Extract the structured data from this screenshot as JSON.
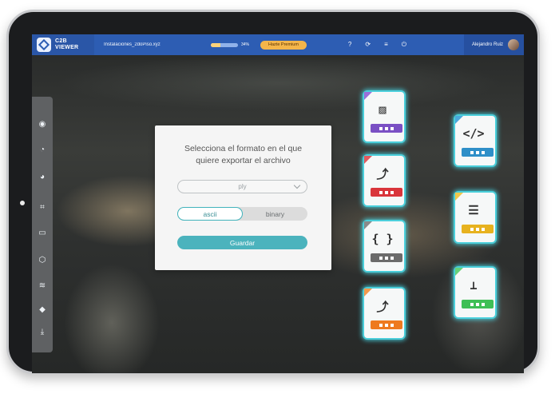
{
  "app": {
    "name_line1": "C2B",
    "name_line2": "VIEWER"
  },
  "file": {
    "name": "Instalaciones_2doPiso.xyz"
  },
  "progress": {
    "percent": 34,
    "label": "34%"
  },
  "premium": {
    "label": "Hazte Premium"
  },
  "header_icons": [
    "help-icon",
    "sync-icon",
    "menu-icon",
    "power-icon"
  ],
  "header_icon_glyphs": [
    "?",
    "⟳",
    "≡",
    "⏻"
  ],
  "user": {
    "name": "Alejandro Ruiz"
  },
  "sidebar": {
    "icons": [
      "target-icon",
      "palette-icon",
      "palette-add-icon",
      "crop-icon",
      "ruler-icon",
      "cube-icon",
      "layers-icon",
      "layer-fill-icon",
      "download-icon"
    ],
    "glyphs": [
      "◉",
      "◔",
      "◕",
      "⌗",
      "▭",
      "⬡",
      "≋",
      "◆",
      "⤓"
    ]
  },
  "dialog": {
    "title_line1": "Selecciona el formato en el que",
    "title_line2": "quiere exportar el archivo",
    "format": {
      "selected": "ply"
    },
    "encoding": {
      "options": [
        "ascii",
        "binary"
      ],
      "selected": "ascii"
    },
    "save_label": "Guardar"
  },
  "export_formats": [
    {
      "name": "image-file-icon",
      "color": "#7a50c4",
      "corner": "#9a6fd8",
      "glyph": "▨"
    },
    {
      "name": "code-file-icon",
      "color": "#2e8fc8",
      "corner": "#4aa9db",
      "glyph": "</>"
    },
    {
      "name": "vector-file-icon-red",
      "color": "#d9353b",
      "corner": "#e15a5f",
      "glyph": "⤴"
    },
    {
      "name": "form-file-icon",
      "color": "#e7b21f",
      "corner": "#f0c74a",
      "glyph": "☰"
    },
    {
      "name": "json-file-icon",
      "color": "#6b6b6b",
      "corner": "#8a8a8a",
      "glyph": "{ }"
    },
    {
      "name": "ruler-file-icon",
      "color": "#3fbf55",
      "corner": "#66d27a",
      "glyph": "⟂"
    },
    {
      "name": "vector-file-icon-orange",
      "color": "#ee7a1f",
      "corner": "#f39a4d",
      "glyph": "⤴"
    }
  ]
}
